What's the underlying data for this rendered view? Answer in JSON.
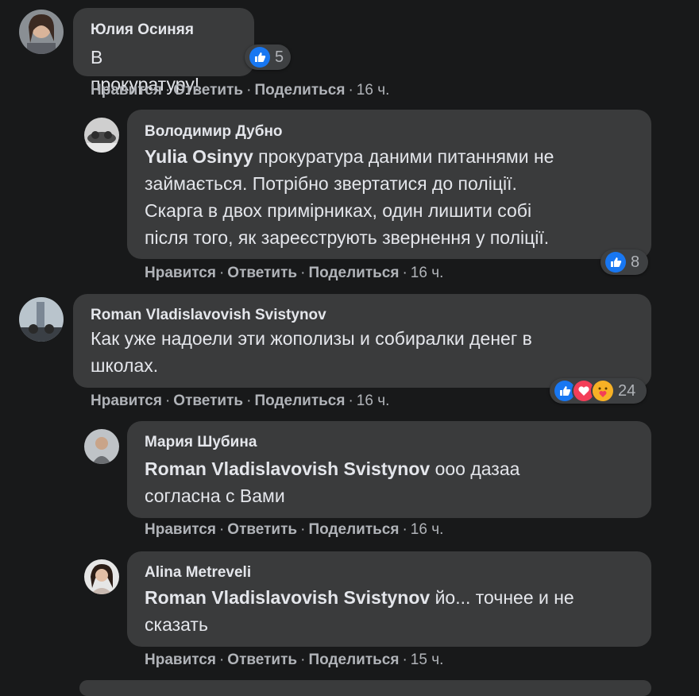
{
  "comments": [
    {
      "author": "Юлия Осиняя",
      "text": "В прокуратуру!",
      "actions": {
        "like": "Нравится",
        "reply": "Ответить",
        "share": "Поделиться",
        "time": "16 ч."
      },
      "reactions": {
        "count": "5",
        "icons": [
          "like-icon"
        ]
      }
    },
    {
      "author": "Володимир Дубно",
      "mention": "Yulia Osinyy",
      "text_lines": [
        " прокуратура даними питаннями не",
        "займається. Потрібно звертатися до поліції.",
        "Скарга в двох примірниках, один лишити собі",
        "після того, як зареєструють звернення у поліції."
      ],
      "actions": {
        "like": "Нравится",
        "reply": "Ответить",
        "share": "Поделиться",
        "time": "16 ч."
      },
      "reactions": {
        "count": "8",
        "icons": [
          "like-icon"
        ]
      }
    },
    {
      "author": "Roman Vladislavovish Svistynov",
      "text_lines": [
        "Как уже надоели эти жополизы и собиралки денег в",
        "школах."
      ],
      "actions": {
        "like": "Нравится",
        "reply": "Ответить",
        "share": "Поделиться",
        "time": "16 ч."
      },
      "reactions": {
        "count": "24",
        "icons": [
          "like-icon",
          "love-icon",
          "care-icon"
        ]
      }
    },
    {
      "author": "Мария Шубина",
      "mention": "Roman Vladislavovish Svistynov",
      "text_lines": [
        " ооо дазаа",
        "согласна с Вами"
      ],
      "actions": {
        "like": "Нравится",
        "reply": "Ответить",
        "share": "Поделиться",
        "time": "16 ч."
      }
    },
    {
      "author": "Alina Metreveli",
      "mention": "Roman Vladislavovish Svistynov",
      "text_lines": [
        " йо... точнее и не",
        "сказать"
      ],
      "actions": {
        "like": "Нравится",
        "reply": "Ответить",
        "share": "Поделиться",
        "time": "15 ч."
      }
    }
  ],
  "colors": {
    "background": "#18191a",
    "bubble": "#3a3b3c",
    "text": "#e4e6eb",
    "muted": "#b0b3b8",
    "like": "#1877f2",
    "love": "#f33e58",
    "care": "#f7b125"
  }
}
